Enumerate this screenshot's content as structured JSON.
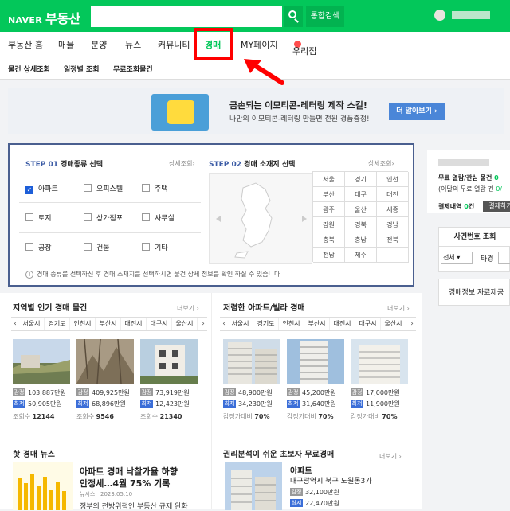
{
  "header": {
    "logo_brand": "NAVER",
    "logo_text": "부동산",
    "search_placeholder": "",
    "search_button_label": "통합검색",
    "search_icon": "search-icon"
  },
  "nav": {
    "items": [
      {
        "label": "부동산 홈"
      },
      {
        "label": "매물"
      },
      {
        "label": "분양"
      },
      {
        "label": "뉴스"
      },
      {
        "label": "커뮤니티"
      },
      {
        "label": "경매",
        "active": true
      },
      {
        "label": "MY페이지"
      },
      {
        "label": "우리집",
        "badge": "N"
      }
    ]
  },
  "subnav": {
    "items": [
      {
        "label": "물건 상세조회"
      },
      {
        "label": "일정별 조회"
      },
      {
        "label": "무료조회물건"
      }
    ]
  },
  "banner": {
    "title": "금손되는 이모티콘-레터링 제작 스킬!",
    "subtitle": "나만의 이모티콘-레터링 만들면 전원 경품증정!",
    "button_label": "더 알아보기 ›"
  },
  "step1": {
    "num": "STEP 01",
    "title": "경매종류 선택",
    "detail_link": "상세조회›",
    "options": [
      {
        "label": "아파트",
        "checked": true
      },
      {
        "label": "오피스텔",
        "checked": false
      },
      {
        "label": "주택",
        "checked": false
      },
      {
        "label": "토지",
        "checked": false
      },
      {
        "label": "상가점포",
        "checked": false
      },
      {
        "label": "사무실",
        "checked": false
      },
      {
        "label": "공장",
        "checked": false
      },
      {
        "label": "건물",
        "checked": false
      },
      {
        "label": "기타",
        "checked": false
      }
    ]
  },
  "step2": {
    "num": "STEP 02",
    "title": "경매 소재지 선택",
    "detail_link": "상세조회›",
    "regions": [
      "서울",
      "경기",
      "인천",
      "부산",
      "대구",
      "대전",
      "광주",
      "울산",
      "세종",
      "강원",
      "경북",
      "경남",
      "충북",
      "충남",
      "전북",
      "전남",
      "제주",
      ""
    ]
  },
  "note": {
    "icon": "info-icon",
    "text": "경매 종류를 선택하신 후 경매 소재지를 선택하시면 물건 상세 정보를 확인 하실 수 있습니다"
  },
  "sidebar": {
    "free_title": "무료 열람/관심 물건",
    "free_title_suffix": "0",
    "free_sub": "(이달의 무료 열람 건",
    "free_sub_suffix": "0/",
    "pay_label": "결제내역",
    "pay_count": "0",
    "pay_unit": "건",
    "pay_button": "결제하기",
    "case_search_title": "사건번호 조회",
    "court_select": "전체",
    "case_label": "타경",
    "info_link": "경매정보 자료제공"
  },
  "popular": {
    "title": "지역별 인기 경매 물건",
    "more": "더보기 ›",
    "tabs": [
      "서울시",
      "경기도",
      "인천시",
      "부산시",
      "대전시",
      "대구시",
      "울산시"
    ],
    "items": [
      {
        "appraisal": "103,887만원",
        "minimum": "50,905만원",
        "views_label": "조회수",
        "views": "12144"
      },
      {
        "appraisal": "409,925만원",
        "minimum": "68,896만원",
        "views_label": "조회수",
        "views": "9546"
      },
      {
        "appraisal": "73,919만원",
        "minimum": "12,423만원",
        "views_label": "조회수",
        "views": "21340"
      }
    ],
    "tag_appraisal": "감정",
    "tag_minimum": "최저"
  },
  "cheap": {
    "title": "저렴한 아파트/빌라 경매",
    "more": "더보기 ›",
    "tabs": [
      "서울시",
      "경기도",
      "인천시",
      "부산시",
      "대전시",
      "대구시",
      "울산시"
    ],
    "items": [
      {
        "appraisal": "48,900만원",
        "minimum": "34,230만원",
        "ratio_label": "감정가대비",
        "ratio": "70%"
      },
      {
        "appraisal": "45,200만원",
        "minimum": "31,640만원",
        "ratio_label": "감정가대비",
        "ratio": "70%"
      },
      {
        "appraisal": "17,000만원",
        "minimum": "11,900만원",
        "ratio_label": "감정가대비",
        "ratio": "70%"
      }
    ]
  },
  "news": {
    "title": "핫 경매 뉴스",
    "headline_1": "아파트 경매 낙찰가율 하향",
    "headline_2": "안정세…4월 75% 기록",
    "source": "뉴시스",
    "date": "2023.05.10",
    "desc": "정부의 전방위적인 부동산 규제 완화"
  },
  "analysis": {
    "title": "권리분석이 쉬운 초보자 무료경매",
    "more": "더보기 ›",
    "item_type": "아파트",
    "item_addr": "대구광역시 북구 노원동3가",
    "appraisal": "32,100만원",
    "minimum": "22,470만원"
  },
  "colors": {
    "brand": "#03c75a",
    "highlight": "#ff0000",
    "step": "#3b5ba5",
    "tag_minimum": "#3b6ed8"
  }
}
